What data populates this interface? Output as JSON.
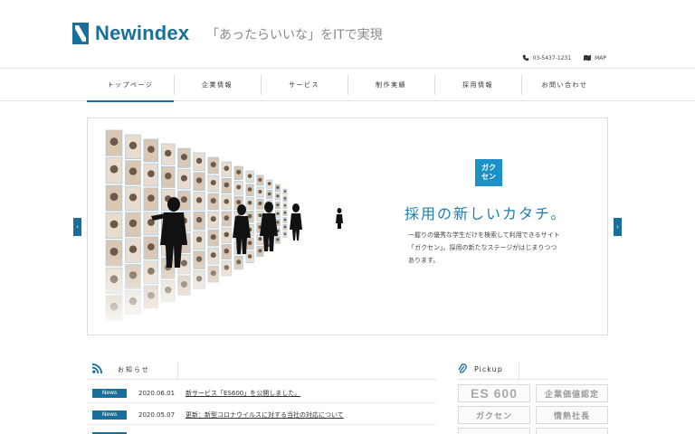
{
  "header": {
    "logo_text": "Newindex",
    "tagline": "「あったらいいな」をITで実現",
    "phone": "03-5437-1231",
    "map_label": "MAP"
  },
  "nav": [
    {
      "label": "トップページ",
      "active": true
    },
    {
      "label": "企業情報"
    },
    {
      "label": "サービス"
    },
    {
      "label": "制作実績"
    },
    {
      "label": "採用情報"
    },
    {
      "label": "お問い合わせ"
    }
  ],
  "slider": {
    "badge_line1": "ガク",
    "badge_line2": "セン",
    "headline": "採用の新しいカタチ。",
    "text_line1": "一握りの優秀な学生だけを検索して利用できるサイト",
    "text_line2": "「ガクセン」。採用の新たなステージがはじまりつつ",
    "text_line3": "あります。"
  },
  "news": {
    "title": "お知らせ",
    "items": [
      {
        "tag": "News",
        "date": "2020.06.01",
        "text": "新サービス「ES600」を公開しました。"
      },
      {
        "tag": "News",
        "date": "2020.05.07",
        "text": "更新：新型コロナウイルスに対する当社の対応について"
      }
    ]
  },
  "pickup": {
    "title": "Pickup",
    "banners": [
      "ES 600",
      "企業価値認定",
      "ガクセン",
      "情熱社長"
    ]
  },
  "colors": {
    "brand": "#1a6f9a",
    "accent": "#1b91c7"
  }
}
